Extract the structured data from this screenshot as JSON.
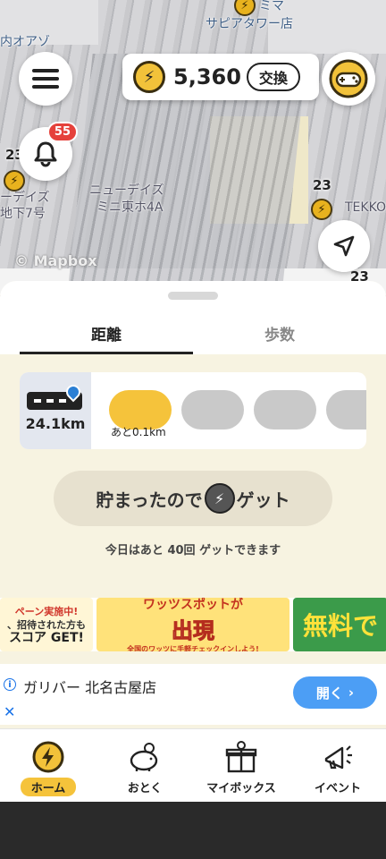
{
  "map": {
    "labels": [
      {
        "text": "内オアゾ"
      },
      {
        "text": "サピアタワー店"
      },
      {
        "text": "ミマ"
      },
      {
        "text": "ニューデイズ"
      },
      {
        "text": "ミニ東ホ4A"
      },
      {
        "text": "ーデイズ"
      },
      {
        "text": "地下7号"
      },
      {
        "text": "TEKKO"
      }
    ],
    "numbers": [
      "23",
      "23",
      "23"
    ],
    "attribution": "© Mapbox"
  },
  "header": {
    "coin_amount": "5,360",
    "exchange_label": "交換",
    "notification_count": "55"
  },
  "panel": {
    "tabs": [
      {
        "label": "距離",
        "active": true
      },
      {
        "label": "歩数",
        "active": false
      }
    ],
    "distance_value": "24.1km",
    "progress": {
      "filled_segments": 1,
      "total_segments_visible": 4,
      "remaining_label": "あと0.1km"
    },
    "get_button": {
      "prefix": "貯まったので",
      "suffix": "ゲット"
    },
    "today_text": "今日はあと 40回 ゲットできます"
  },
  "banners": [
    {
      "text_lines": [
        "ペーン実施中!",
        "、招待された方も",
        "スコア GET!"
      ]
    },
    {
      "text_lines": [
        "ワッツスポットが",
        "出現",
        "全国のワッツに手軽チェックインしよう!"
      ]
    },
    {
      "text_lines": [
        "無料で"
      ]
    }
  ],
  "ad": {
    "title": "ガリバー 北名古屋店",
    "open_label": "開く",
    "close_icon": "close-icon",
    "info_icon": "info-icon"
  },
  "bottom_nav": [
    {
      "label": "ホーム",
      "icon": "bolt-coin-icon",
      "active": true
    },
    {
      "label": "おとく",
      "icon": "piggy-bank-icon",
      "active": false
    },
    {
      "label": "マイボックス",
      "icon": "gift-box-icon",
      "active": false
    },
    {
      "label": "イベント",
      "icon": "megaphone-icon",
      "active": false
    }
  ],
  "colors": {
    "accent_yellow": "#f5c33b",
    "panel_bg": "#f7f3e1",
    "ad_button_blue": "#4c9ef5",
    "badge_red": "#e5413b"
  }
}
